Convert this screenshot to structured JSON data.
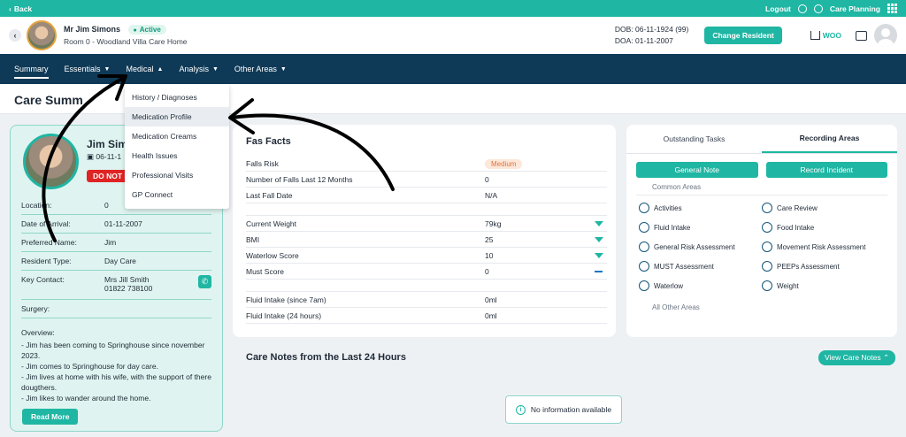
{
  "topbar": {
    "back": "Back",
    "logout": "Logout",
    "care_planning": "Care Planning"
  },
  "resident": {
    "name": "Mr Jim Simons",
    "status": "Active",
    "room": "Room 0 - Woodland Villa Care Home",
    "dob": "DOB: 06-11-1924 (99)",
    "doa": "DOA: 01-11-2007",
    "change_label": "Change Resident",
    "home_label": "WOO"
  },
  "nav": {
    "tabs": [
      {
        "label": "Summary"
      },
      {
        "label": "Essentials"
      },
      {
        "label": "Medical"
      },
      {
        "label": "Analysis"
      },
      {
        "label": "Other Areas"
      }
    ]
  },
  "page_title": "Care Summ",
  "dropdown": {
    "items": [
      {
        "label": "History / Diagnoses"
      },
      {
        "label": "Medication Profile"
      },
      {
        "label": "Medication Creams"
      },
      {
        "label": "Health Issues"
      },
      {
        "label": "Professional Visits"
      },
      {
        "label": "GP Connect"
      }
    ]
  },
  "summary": {
    "name": "Jim Sim",
    "dob": "06-11-1",
    "dnr": "DO NOT R",
    "rows": [
      {
        "label": "Location:",
        "value": "0"
      },
      {
        "label": "Date of Arrival:",
        "value": "01-11-2007"
      },
      {
        "label": "Preferred Name:",
        "value": "Jim"
      },
      {
        "label": "Resident Type:",
        "value": "Day Care"
      },
      {
        "label": "Key Contact:",
        "value": "Mrs Jill Smith",
        "value2": "01822 738100"
      },
      {
        "label": "Surgery:",
        "value": ""
      }
    ],
    "overview_label": "Overview:",
    "overview": [
      "- Jim has been coming to Springhouse since november 2023.",
      "- Jim comes to Springhouse for day care.",
      "- Jim lives at home with his wife, with the support of there dougthers.",
      "- Jim likes to wander around the home."
    ],
    "read_more": "Read More"
  },
  "fast_facts": {
    "title": "Fast Facts",
    "title_visible": "Fas Facts",
    "rows": [
      {
        "label": "Falls Risk",
        "value": "Medium",
        "type": "pill"
      },
      {
        "label": "Number of Falls Last 12 Months",
        "value": "0"
      },
      {
        "label": "Last Fall Date",
        "value": "N/A"
      },
      {
        "label": "Current Weight",
        "value": "79kg",
        "trend": "down"
      },
      {
        "label": "BMI",
        "value": "25",
        "trend": "down"
      },
      {
        "label": "Waterlow Score",
        "value": "10",
        "trend": "down"
      },
      {
        "label": "Must Score",
        "value": "0",
        "trend": "flat"
      },
      {
        "label": "Fluid Intake (since 7am)",
        "value": "0ml"
      },
      {
        "label": "Fluid Intake (24 hours)",
        "value": "0ml"
      }
    ]
  },
  "records": {
    "tabs": [
      "Outstanding Tasks",
      "Recording Areas"
    ],
    "general_note": "General Note",
    "record_incident": "Record Incident",
    "common_label": "Common Areas",
    "items": [
      "Activities",
      "Care Review",
      "Fluid Intake",
      "Food Intake",
      "General Risk Assessment",
      "Movement Risk Assessment",
      "MUST Assessment",
      "PEEPs Assessment",
      "Waterlow",
      "Weight"
    ],
    "other_label": "All Other Areas"
  },
  "care_notes": {
    "title": "Care Notes from the Last 24 Hours",
    "view_label": "View Care Notes",
    "empty": "No information available"
  },
  "colors": {
    "accent": "#1fb6a3",
    "nav": "#0f3a57",
    "danger": "#e02424"
  }
}
